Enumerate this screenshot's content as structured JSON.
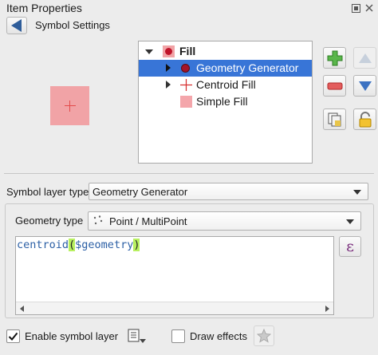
{
  "panel": {
    "title": "Item Properties",
    "float_icon": "float-icon",
    "close_icon": "close-icon"
  },
  "header": {
    "back_icon": "back-arrow-icon",
    "title": "Symbol Settings"
  },
  "tree": {
    "items": [
      {
        "label": "Fill",
        "icon": "fill-marker-icon",
        "expanded": true,
        "bold": true
      },
      {
        "label": "Geometry Generator",
        "icon": "geometry-generator-icon",
        "selected": true
      },
      {
        "label": "Centroid Fill",
        "icon": "centroid-fill-icon"
      },
      {
        "label": "Simple Fill",
        "icon": "simple-fill-icon"
      }
    ]
  },
  "tools": {
    "add": "add-layer-icon",
    "remove": "remove-layer-icon",
    "move_up": "move-up-icon",
    "move_down": "move-down-icon",
    "duplicate": "duplicate-layer-icon",
    "lock": "lock-icon"
  },
  "symbol_layer_type": {
    "label": "Symbol layer type",
    "value": "Geometry Generator"
  },
  "geometry_type": {
    "label": "Geometry type",
    "value": "Point / MultiPoint",
    "icon": "point-multipoint-icon"
  },
  "expression": {
    "func": "centroid",
    "open_paren": "(",
    "arg": "$geometry",
    "close_paren": ")",
    "button_glyph": "ε"
  },
  "bottom": {
    "enable_label": "Enable symbol layer",
    "enable_checked": true,
    "draw_effects_label": "Draw effects",
    "draw_effects_checked": false,
    "data_defined_icon": "data-defined-menu-icon",
    "effects_icon": "star-effects-icon"
  },
  "colors": {
    "accent": "#3875d7",
    "fill": "#f1a3a6",
    "marker": "#c0142a",
    "expression_text": "#2b5fa5"
  }
}
